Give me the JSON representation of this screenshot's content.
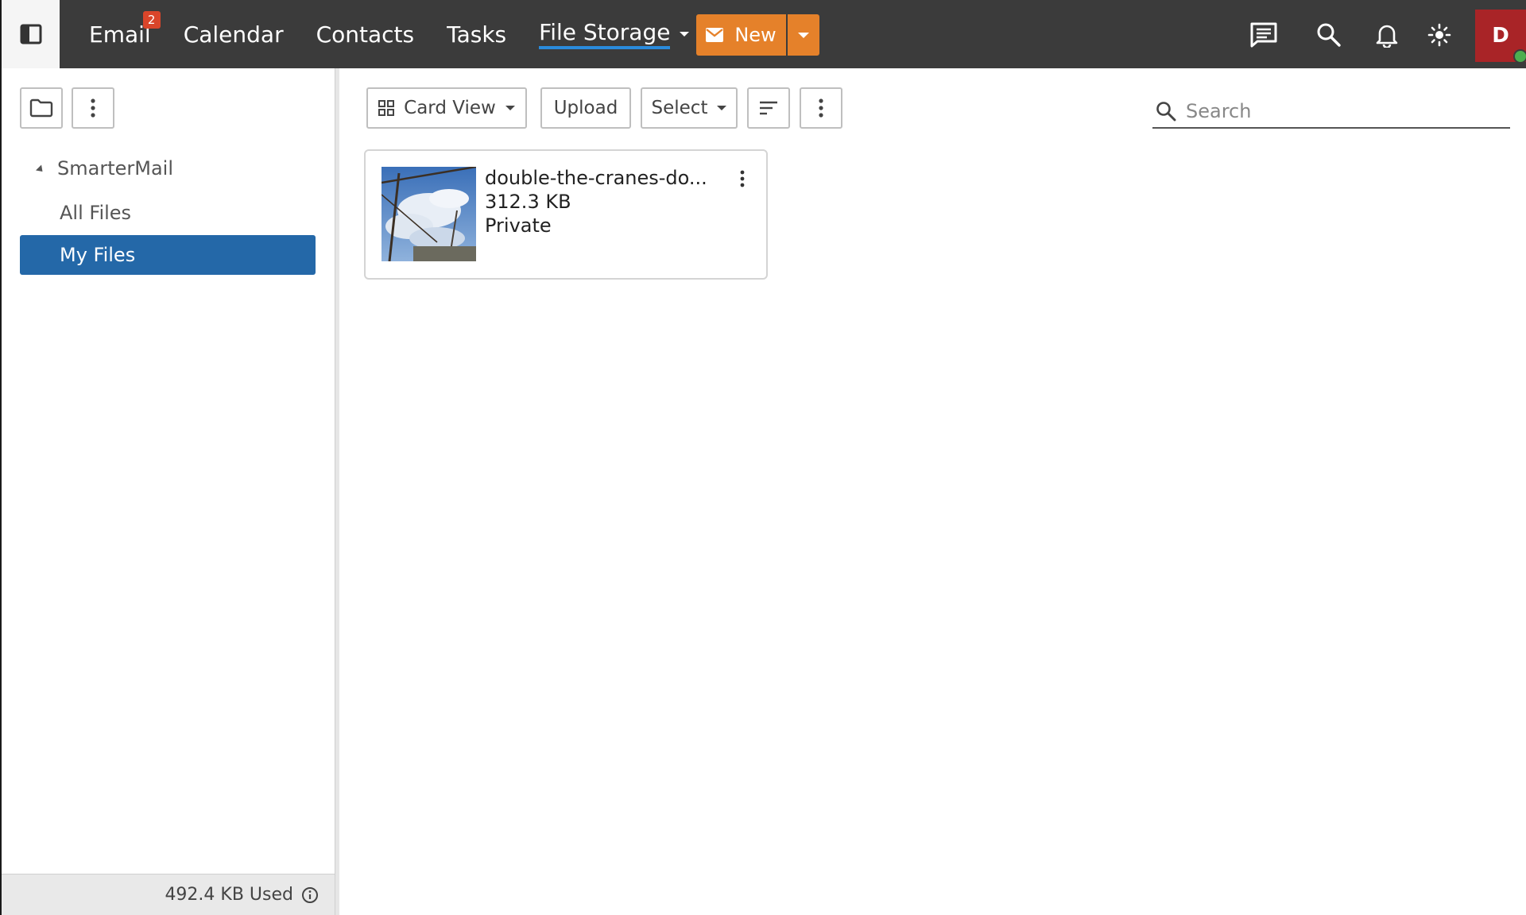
{
  "topbar": {
    "nav": [
      {
        "label": "Email",
        "badge": "2"
      },
      {
        "label": "Calendar"
      },
      {
        "label": "Contacts"
      },
      {
        "label": "Tasks"
      },
      {
        "label": "File Storage",
        "active": true
      }
    ],
    "new_label": "New",
    "icons": [
      "chat-icon",
      "search-icon",
      "bell-icon",
      "brightness-icon"
    ],
    "avatar_initial": "D",
    "accent_color": "#e5812a"
  },
  "sidebar": {
    "root_label": "SmarterMail",
    "items": [
      {
        "label": "All Files"
      },
      {
        "label": "My Files",
        "selected": true
      }
    ],
    "storage_used": "492.4 KB Used"
  },
  "toolbar": {
    "view_label": "Card View",
    "upload_label": "Upload",
    "select_label": "Select",
    "search_placeholder": "Search"
  },
  "files": [
    {
      "name": "double-the-cranes-do...",
      "size": "312.3 KB",
      "visibility": "Private"
    }
  ]
}
